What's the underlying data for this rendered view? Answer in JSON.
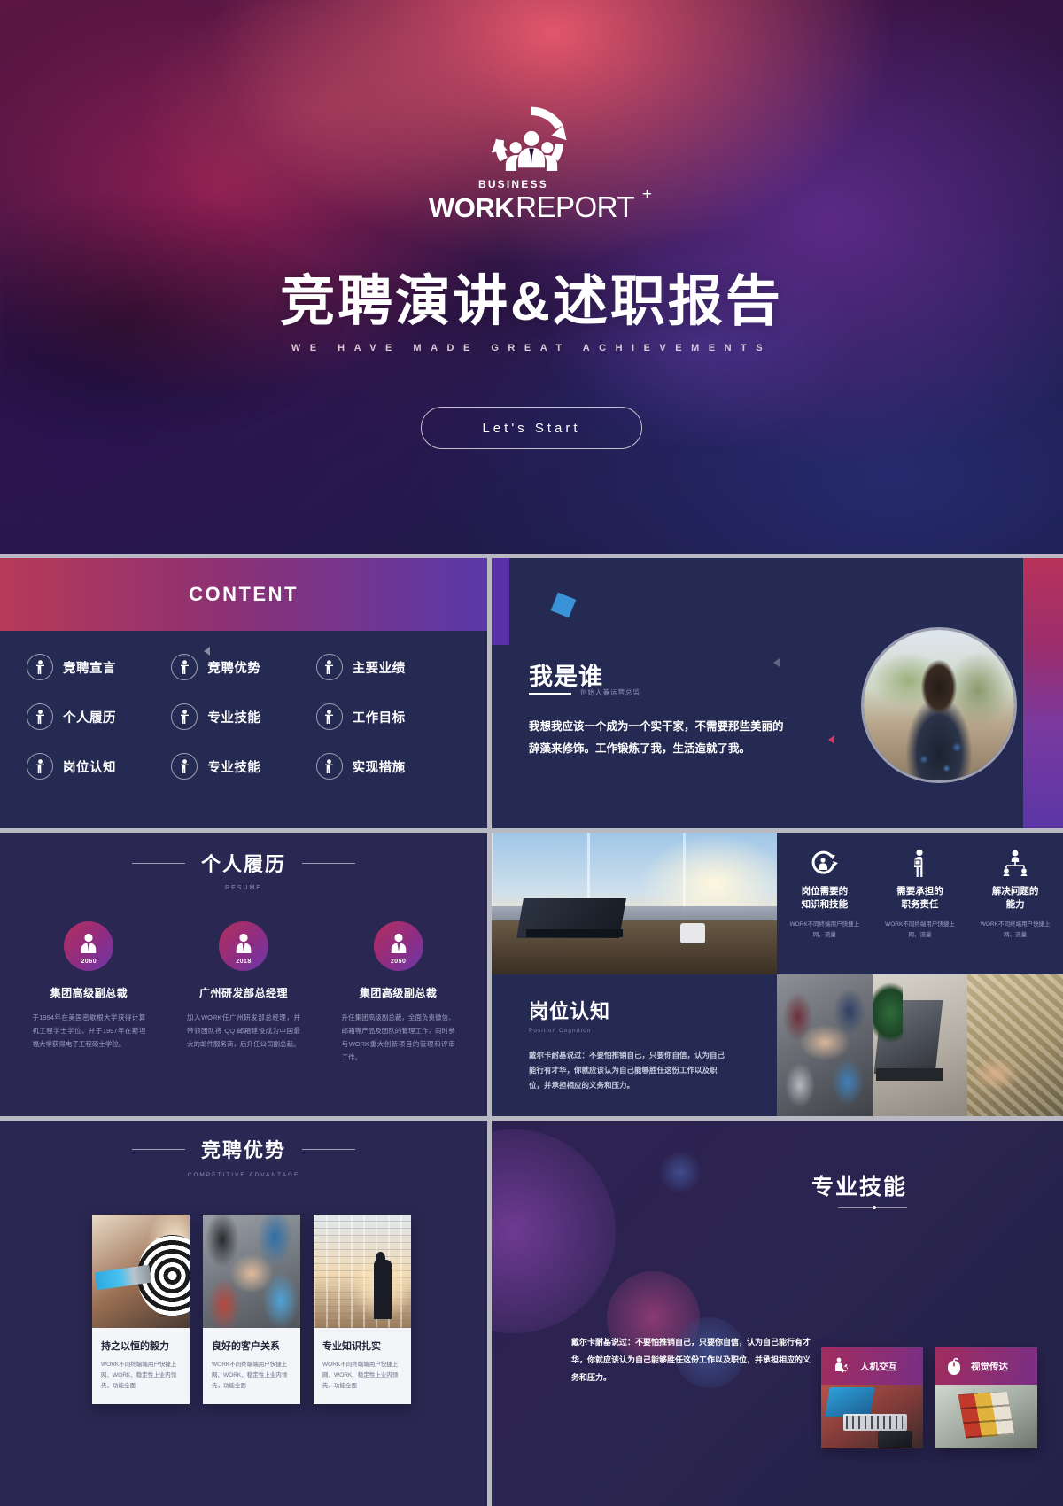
{
  "cover": {
    "logo_icon": "business-people-cycle-logo",
    "brand_small": "BUSINESS",
    "brand_work": "WORK",
    "brand_report": "REPORT",
    "brand_plus": "+",
    "title": "竞聘演讲&述职报告",
    "subtitle": "WE HAVE MADE GREAT ACHIEVEMENTS",
    "start_button": "Let's Start"
  },
  "content": {
    "heading": "CONTENT",
    "items": [
      {
        "label": "竞聘宣言",
        "icon": "person-icon"
      },
      {
        "label": "竞聘优势",
        "icon": "person-icon"
      },
      {
        "label": "主要业绩",
        "icon": "person-icon"
      },
      {
        "label": "个人履历",
        "icon": "person-icon"
      },
      {
        "label": "专业技能",
        "icon": "person-icon"
      },
      {
        "label": "工作目标",
        "icon": "person-icon"
      },
      {
        "label": "岗位认知",
        "icon": "person-icon"
      },
      {
        "label": "专业技能",
        "icon": "person-icon"
      },
      {
        "label": "实现措施",
        "icon": "person-icon"
      }
    ]
  },
  "who_am_i": {
    "title": "我是谁",
    "subtitle": "创始人兼运营总监",
    "body": "我想我应该一个成为一个实干家，不需要那些美丽的辞藻来修饰。工作锻炼了我，生活造就了我。",
    "photo_alt": "woman-walking-away-photo"
  },
  "resume": {
    "title": "个人履历",
    "subtitle": "RESUME",
    "entries": [
      {
        "year": "2060",
        "name": "集团高级副总裁",
        "desc": "于1994年在美国密歇根大学获得计算机工程学士学位，并于1997年在斯坦福大学获得电子工程硕士学位。"
      },
      {
        "year": "2018",
        "name": "广州研发部总经理",
        "desc": "加入WORK任广州研发部总经理，并带领团队将 QQ 邮箱建设成为中国最大的邮件服务商，后升任公司副总裁。"
      },
      {
        "year": "2050",
        "name": "集团高级副总裁",
        "desc": "升任集团高级副总裁，全面负责微信、邮箱等产品及团队的管理工作，同时参与WORK重大创新项目的管理和评审工作。"
      }
    ]
  },
  "position_cognition": {
    "title": "岗位认知",
    "subtitle": "Position Cognition",
    "body": "戴尔卡耐基说过：不要怕推销自己，只要你自信，认为自己能行有才华，你就应该认为自己能够胜任这份工作以及职位，并承担相应的义务和压力。",
    "cells": [
      {
        "icon": "person-growth-arrow-icon",
        "title": "岗位需要的\n知识和技能",
        "title_l1": "岗位需要的",
        "title_l2": "知识和技能",
        "text": "WORK不同终端用户快捷上网、流量"
      },
      {
        "icon": "businessman-icon",
        "title_l1": "需要承担的",
        "title_l2": "职务责任",
        "text": "WORK不同终端用户快捷上网、流量"
      },
      {
        "icon": "team-network-icon",
        "title_l1": "解决问题的",
        "title_l2": "能力",
        "text": "WORK不同终端用户快捷上网、流量"
      }
    ],
    "main_photo_alt": "laptop-on-desk-city-view-photo",
    "strip_photos": [
      "team-hands-together-photo",
      "laptop-desk-plant-photo",
      "hands-holding-money-photo"
    ]
  },
  "advantages": {
    "title": "竞聘优势",
    "subtitle": "COMPETITIVE ADVANTAGE",
    "cards": [
      {
        "photo_alt": "dart-bullseye-photo",
        "title": "持之以恒的毅力",
        "text": "WORK不同终端端用户快捷上网、WORK、稳定性上业内领先，功能全面"
      },
      {
        "photo_alt": "team-hands-photo",
        "title": "良好的客户关系",
        "text": "WORK不同终端端用户快捷上网、WORK、稳定性上业内领先，功能全面"
      },
      {
        "photo_alt": "businessman-window-photo",
        "title": "专业知识扎实",
        "text": "WORK不同终端端用户快捷上网、WORK、稳定性上业内领先，功能全面"
      }
    ]
  },
  "skills": {
    "title": "专业技能",
    "body": "戴尔卡耐基说过：不要怕推销自己，只要你自信，认为自己能行有才华，你就应该认为自己能够胜任这份工作以及职位，并承担相应的义务和压力。",
    "cards": [
      {
        "icon": "gear-person-icon",
        "label": "人机交互",
        "photo_alt": "desk-keyboard-tablet-photo"
      },
      {
        "icon": "mouse-icon",
        "label": "视觉传达",
        "photo_alt": "rubiks-cube-photo"
      }
    ]
  },
  "colors": {
    "deck_gap": "#b9b9c4",
    "panel_bg": "#252a52",
    "accent_pink": "#b8325a",
    "accent_purple": "#5b31a8",
    "accent_blue": "#3a93d6"
  }
}
